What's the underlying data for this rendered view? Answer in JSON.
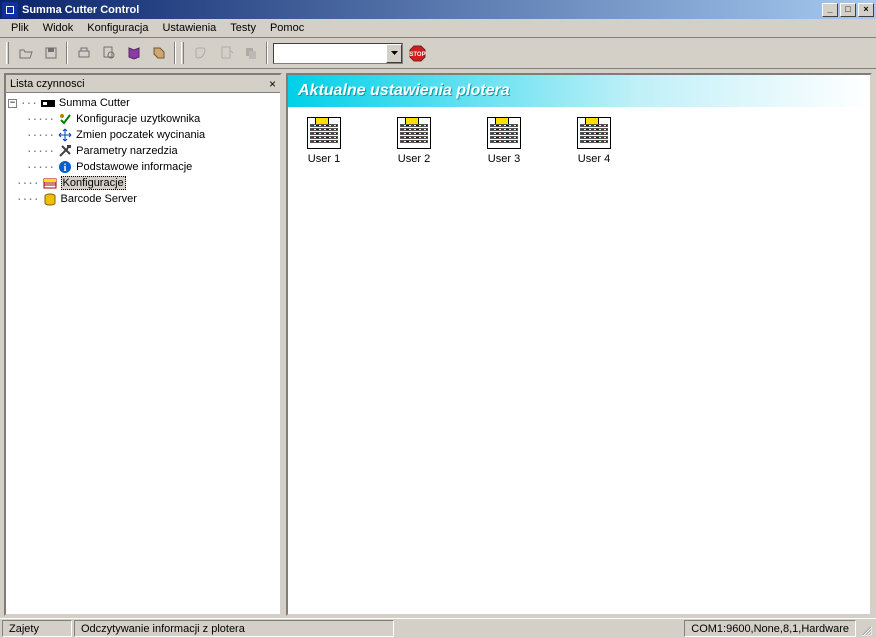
{
  "window": {
    "title": "Summa Cutter Control"
  },
  "menu": {
    "items": [
      "Plik",
      "Widok",
      "Konfiguracja",
      "Ustawienia",
      "Testy",
      "Pomoc"
    ]
  },
  "tree": {
    "header": "Lista czynnosci",
    "root": {
      "label": "Summa Cutter",
      "children": [
        {
          "label": "Konfiguracje uzytkownika",
          "icon": "wrench-check"
        },
        {
          "label": "Zmien poczatek wycinania",
          "icon": "move-arrows"
        },
        {
          "label": "Parametry narzedzia",
          "icon": "hammer-wrench"
        },
        {
          "label": "Podstawowe informacje",
          "icon": "info"
        }
      ]
    },
    "siblings": [
      {
        "label": "Konfiguracje",
        "icon": "folder-sheet",
        "selected": true
      },
      {
        "label": "Barcode Server",
        "icon": "barrel"
      }
    ]
  },
  "content": {
    "header": "Aktualne ustawienia plotera",
    "users": [
      {
        "label": "User 1"
      },
      {
        "label": "User 2"
      },
      {
        "label": "User 3"
      },
      {
        "label": "User 4"
      }
    ]
  },
  "status": {
    "left": "Zajety",
    "middle": "Odczytywanie informacji z plotera",
    "right": "COM1:9600,None,8,1,Hardware"
  }
}
